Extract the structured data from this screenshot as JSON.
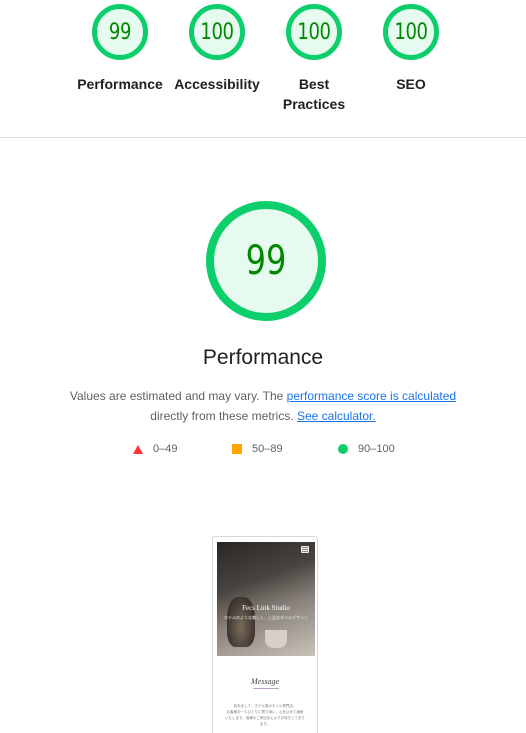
{
  "categories": [
    {
      "score": "99",
      "label": "Performance"
    },
    {
      "score": "100",
      "label": "Accessibility"
    },
    {
      "score": "100",
      "label": "Best\nPractices"
    },
    {
      "score": "100",
      "label": "SEO"
    }
  ],
  "main": {
    "score": "99",
    "title": "Performance",
    "desc_part1": "Values are estimated and may vary. The ",
    "link_score": "performance score is calculated",
    "desc_part2": " directly from these metrics. ",
    "link_calc": "See calculator."
  },
  "legend": [
    {
      "range": "0–49",
      "color": "#ff3333"
    },
    {
      "range": "50–89",
      "color": "#ffa400"
    },
    {
      "range": "90–100",
      "color": "#0cce6b"
    }
  ],
  "thumbnail": {
    "hero_title": "Fecs Link Studio",
    "hero_subtitle": "ホテルのような美しく、上品なネイルデザイン",
    "message_heading": "Message",
    "body_line1": "初めまして、ホテル風のネイル専門店。",
    "body_line2": "お客様お一人ひとりに寄り添い、心を込めて施術いたします。皆様のご来店を心よりお待ちしております。"
  },
  "colors": {
    "pass": "#0cce6b",
    "pass_text": "#008800",
    "pass_bg": "#e6faef",
    "link": "#1a73e8"
  }
}
